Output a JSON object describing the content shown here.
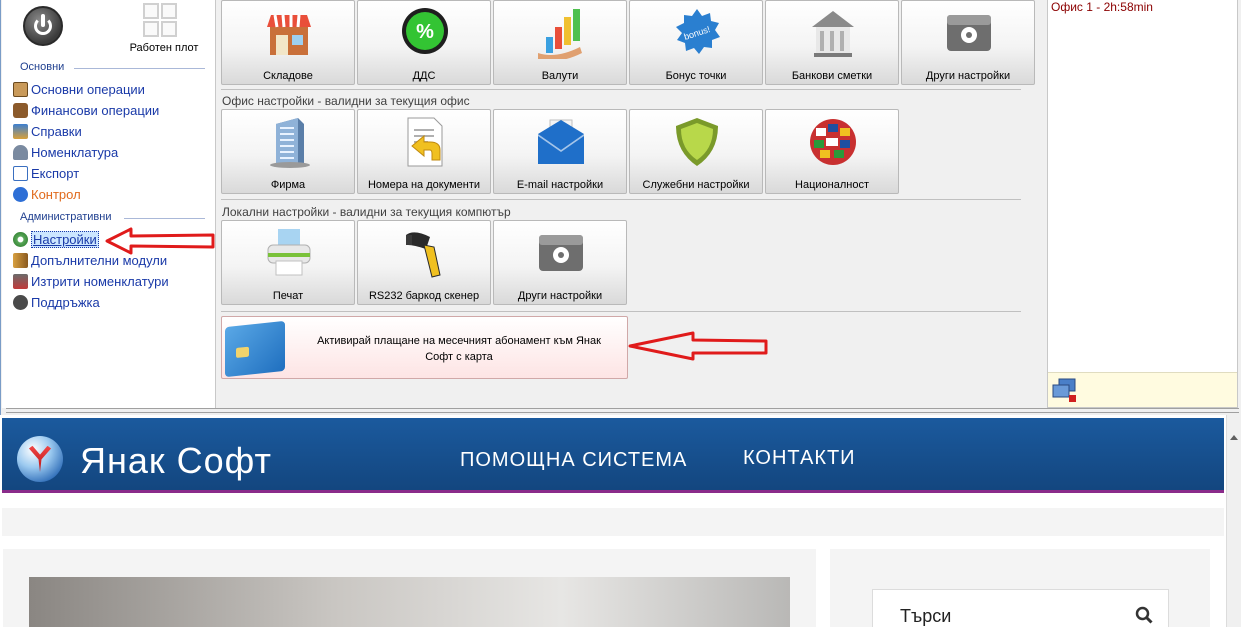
{
  "nav": {
    "desktop_label": "Работен плот",
    "section_basic": "Основни",
    "section_admin": "Административни",
    "items": [
      {
        "label": "Основни операции"
      },
      {
        "label": "Финансови операции"
      },
      {
        "label": "Справки"
      },
      {
        "label": "Номенклатура"
      },
      {
        "label": "Експорт"
      },
      {
        "label": "Контрол"
      },
      {
        "label": "Настройки"
      },
      {
        "label": "Допълнителни модули"
      },
      {
        "label": "Изтрити номенклатури"
      },
      {
        "label": "Поддръжка"
      }
    ]
  },
  "main": {
    "row1": [
      "Складове",
      "ДДС",
      "Валути",
      "Бонус точки",
      "Банкови сметки",
      "Други настройки"
    ],
    "office_group_title": "Офис настройки - валидни за текущия офис",
    "row2": [
      "Фирма",
      "Номера на документи",
      "E-mail настройки",
      "Служебни настройки",
      "Националност"
    ],
    "local_group_title": "Локални настройки - валидни за текущия компютър",
    "row3": [
      "Печат",
      "RS232 баркод скенер",
      "Други настройки"
    ],
    "banner_text": "Активирай плащане на месечният абонамент към Янак Софт с карта",
    "vat_icon_text": "%",
    "bonus_icon_text": "bonus!"
  },
  "side": {
    "office_status": "Офис 1 - 2h:58min"
  },
  "web": {
    "brand": "Янак Софт",
    "menu_help": "ПОМОЩНА СИСТЕМА",
    "menu_contacts": "КОНТАКТИ",
    "search_placeholder": "Търси"
  },
  "colors": {
    "nav_link": "#1a3aa8",
    "control_link": "#e06a1c",
    "arrow": "#e01b1b",
    "header_blue": "#1b5a9e",
    "office_status": "#8b0000"
  }
}
